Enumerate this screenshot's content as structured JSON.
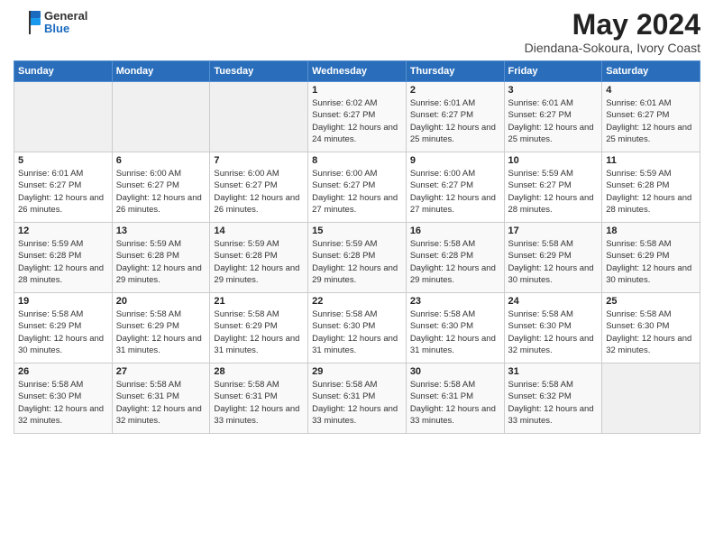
{
  "logo": {
    "text_general": "General",
    "text_blue": "Blue"
  },
  "title": "May 2024",
  "subtitle": "Diendana-Sokoura, Ivory Coast",
  "days_of_week": [
    "Sunday",
    "Monday",
    "Tuesday",
    "Wednesday",
    "Thursday",
    "Friday",
    "Saturday"
  ],
  "weeks": [
    [
      {
        "day": "",
        "content": ""
      },
      {
        "day": "",
        "content": ""
      },
      {
        "day": "",
        "content": ""
      },
      {
        "day": "1",
        "content": "Sunrise: 6:02 AM\nSunset: 6:27 PM\nDaylight: 12 hours and 24 minutes."
      },
      {
        "day": "2",
        "content": "Sunrise: 6:01 AM\nSunset: 6:27 PM\nDaylight: 12 hours and 25 minutes."
      },
      {
        "day": "3",
        "content": "Sunrise: 6:01 AM\nSunset: 6:27 PM\nDaylight: 12 hours and 25 minutes."
      },
      {
        "day": "4",
        "content": "Sunrise: 6:01 AM\nSunset: 6:27 PM\nDaylight: 12 hours and 25 minutes."
      }
    ],
    [
      {
        "day": "5",
        "content": "Sunrise: 6:01 AM\nSunset: 6:27 PM\nDaylight: 12 hours and 26 minutes."
      },
      {
        "day": "6",
        "content": "Sunrise: 6:00 AM\nSunset: 6:27 PM\nDaylight: 12 hours and 26 minutes."
      },
      {
        "day": "7",
        "content": "Sunrise: 6:00 AM\nSunset: 6:27 PM\nDaylight: 12 hours and 26 minutes."
      },
      {
        "day": "8",
        "content": "Sunrise: 6:00 AM\nSunset: 6:27 PM\nDaylight: 12 hours and 27 minutes."
      },
      {
        "day": "9",
        "content": "Sunrise: 6:00 AM\nSunset: 6:27 PM\nDaylight: 12 hours and 27 minutes."
      },
      {
        "day": "10",
        "content": "Sunrise: 5:59 AM\nSunset: 6:27 PM\nDaylight: 12 hours and 28 minutes."
      },
      {
        "day": "11",
        "content": "Sunrise: 5:59 AM\nSunset: 6:28 PM\nDaylight: 12 hours and 28 minutes."
      }
    ],
    [
      {
        "day": "12",
        "content": "Sunrise: 5:59 AM\nSunset: 6:28 PM\nDaylight: 12 hours and 28 minutes."
      },
      {
        "day": "13",
        "content": "Sunrise: 5:59 AM\nSunset: 6:28 PM\nDaylight: 12 hours and 29 minutes."
      },
      {
        "day": "14",
        "content": "Sunrise: 5:59 AM\nSunset: 6:28 PM\nDaylight: 12 hours and 29 minutes."
      },
      {
        "day": "15",
        "content": "Sunrise: 5:59 AM\nSunset: 6:28 PM\nDaylight: 12 hours and 29 minutes."
      },
      {
        "day": "16",
        "content": "Sunrise: 5:58 AM\nSunset: 6:28 PM\nDaylight: 12 hours and 29 minutes."
      },
      {
        "day": "17",
        "content": "Sunrise: 5:58 AM\nSunset: 6:29 PM\nDaylight: 12 hours and 30 minutes."
      },
      {
        "day": "18",
        "content": "Sunrise: 5:58 AM\nSunset: 6:29 PM\nDaylight: 12 hours and 30 minutes."
      }
    ],
    [
      {
        "day": "19",
        "content": "Sunrise: 5:58 AM\nSunset: 6:29 PM\nDaylight: 12 hours and 30 minutes."
      },
      {
        "day": "20",
        "content": "Sunrise: 5:58 AM\nSunset: 6:29 PM\nDaylight: 12 hours and 31 minutes."
      },
      {
        "day": "21",
        "content": "Sunrise: 5:58 AM\nSunset: 6:29 PM\nDaylight: 12 hours and 31 minutes."
      },
      {
        "day": "22",
        "content": "Sunrise: 5:58 AM\nSunset: 6:30 PM\nDaylight: 12 hours and 31 minutes."
      },
      {
        "day": "23",
        "content": "Sunrise: 5:58 AM\nSunset: 6:30 PM\nDaylight: 12 hours and 31 minutes."
      },
      {
        "day": "24",
        "content": "Sunrise: 5:58 AM\nSunset: 6:30 PM\nDaylight: 12 hours and 32 minutes."
      },
      {
        "day": "25",
        "content": "Sunrise: 5:58 AM\nSunset: 6:30 PM\nDaylight: 12 hours and 32 minutes."
      }
    ],
    [
      {
        "day": "26",
        "content": "Sunrise: 5:58 AM\nSunset: 6:30 PM\nDaylight: 12 hours and 32 minutes."
      },
      {
        "day": "27",
        "content": "Sunrise: 5:58 AM\nSunset: 6:31 PM\nDaylight: 12 hours and 32 minutes."
      },
      {
        "day": "28",
        "content": "Sunrise: 5:58 AM\nSunset: 6:31 PM\nDaylight: 12 hours and 33 minutes."
      },
      {
        "day": "29",
        "content": "Sunrise: 5:58 AM\nSunset: 6:31 PM\nDaylight: 12 hours and 33 minutes."
      },
      {
        "day": "30",
        "content": "Sunrise: 5:58 AM\nSunset: 6:31 PM\nDaylight: 12 hours and 33 minutes."
      },
      {
        "day": "31",
        "content": "Sunrise: 5:58 AM\nSunset: 6:32 PM\nDaylight: 12 hours and 33 minutes."
      },
      {
        "day": "",
        "content": ""
      }
    ]
  ]
}
